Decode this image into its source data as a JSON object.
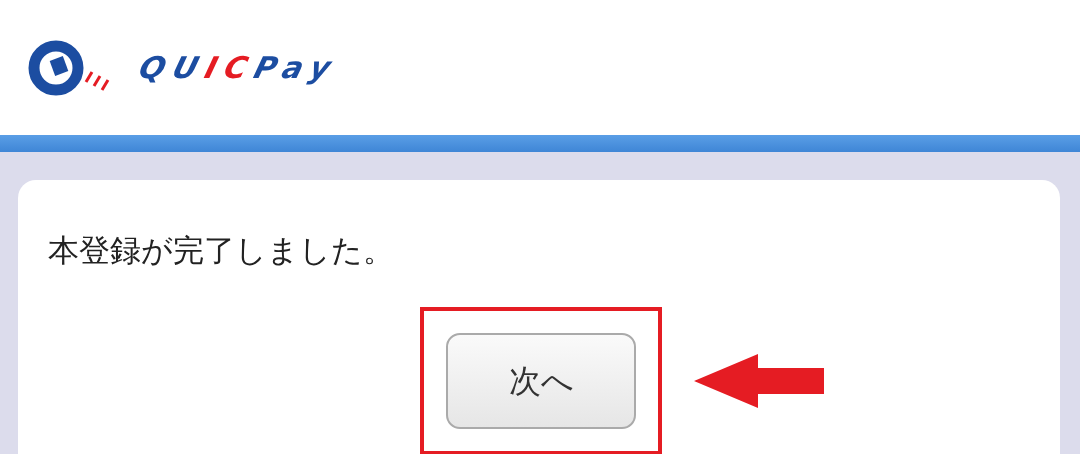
{
  "header": {
    "logo_parts": [
      {
        "text": "QU",
        "accent": false
      },
      {
        "text": "IC",
        "accent": true
      },
      {
        "text": "Pay",
        "accent": false
      }
    ]
  },
  "message": "本登録が完了しました。",
  "next_button": {
    "label": "次へ"
  }
}
